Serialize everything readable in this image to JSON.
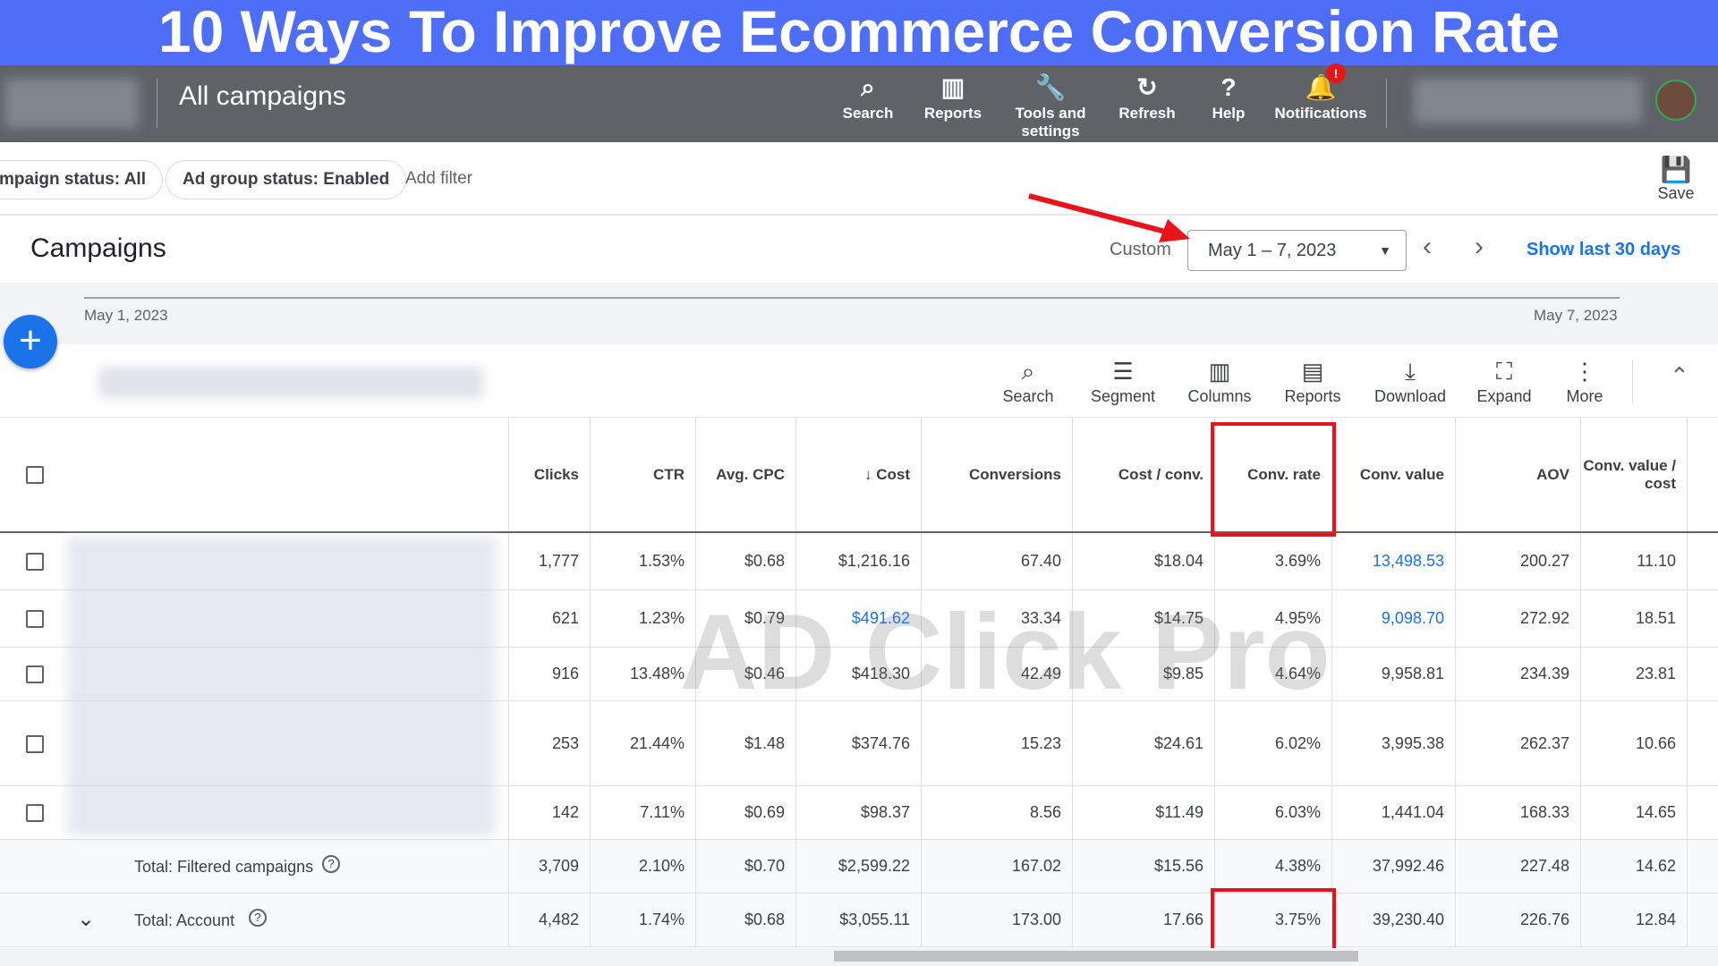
{
  "banner": {
    "title": "10 Ways To Improve Ecommerce Conversion Rate"
  },
  "header": {
    "title": "All campaigns",
    "icons": [
      {
        "label": "Search",
        "icon": "search-icon",
        "glyph": "⌕"
      },
      {
        "label": "Reports",
        "icon": "reports-icon",
        "glyph": "▥"
      },
      {
        "label": "Tools and settings",
        "icon": "wrench-icon",
        "glyph": "🔧"
      },
      {
        "label": "Refresh",
        "icon": "refresh-icon",
        "glyph": "↻"
      },
      {
        "label": "Help",
        "icon": "help-icon",
        "glyph": "?"
      },
      {
        "label": "Notifications",
        "icon": "bell-icon",
        "glyph": "🔔"
      }
    ],
    "notification_badge": "!"
  },
  "filters": {
    "chips": [
      "mpaign status: All",
      "Ad group status: Enabled"
    ],
    "add_filter": "Add filter",
    "save": "Save"
  },
  "campaigns": {
    "title": "Campaigns",
    "range_label": "Custom",
    "date_range": "May 1 – 7, 2023",
    "show_last": "Show last 30 days"
  },
  "timeline": {
    "start": "May 1, 2023",
    "end": "May 7, 2023"
  },
  "toolbar": [
    {
      "label": "Search",
      "icon": "search-icon",
      "glyph": "⌕"
    },
    {
      "label": "Segment",
      "icon": "segment-icon",
      "glyph": "☰"
    },
    {
      "label": "Columns",
      "icon": "columns-icon",
      "glyph": "▥"
    },
    {
      "label": "Reports",
      "icon": "reports-icon",
      "glyph": "▤"
    },
    {
      "label": "Download",
      "icon": "download-icon",
      "glyph": "⤓"
    },
    {
      "label": "Expand",
      "icon": "expand-icon",
      "glyph": "⛶"
    },
    {
      "label": "More",
      "icon": "more-vert-icon",
      "glyph": "⋮"
    }
  ],
  "table": {
    "columns": [
      "Clicks",
      "CTR",
      "Avg. CPC",
      "↓ Cost",
      "Conversions",
      "Cost / conv.",
      "Conv. rate",
      "Conv. value",
      "AOV",
      "Conv. value / cost"
    ],
    "rows": [
      [
        "1,777",
        "1.53%",
        "$0.68",
        "$1,216.16",
        "67.40",
        "$18.04",
        "3.69%",
        "13,498.53",
        "200.27",
        "11.10"
      ],
      [
        "621",
        "1.23%",
        "$0.79",
        "$491.62",
        "33.34",
        "$14.75",
        "4.95%",
        "9,098.70",
        "272.92",
        "18.51"
      ],
      [
        "916",
        "13.48%",
        "$0.46",
        "$418.30",
        "42.49",
        "$9.85",
        "4.64%",
        "9,958.81",
        "234.39",
        "23.81"
      ],
      [
        "253",
        "21.44%",
        "$1.48",
        "$374.76",
        "15.23",
        "$24.61",
        "6.02%",
        "3,995.38",
        "262.37",
        "10.66"
      ],
      [
        "142",
        "7.11%",
        "$0.69",
        "$98.37",
        "8.56",
        "$11.49",
        "6.03%",
        "1,441.04",
        "168.33",
        "14.65"
      ]
    ],
    "totals": [
      {
        "label": "Total: Filtered campaigns",
        "values": [
          "3,709",
          "2.10%",
          "$0.70",
          "$2,599.22",
          "167.02",
          "$15.56",
          "4.38%",
          "37,992.46",
          "227.48",
          "14.62"
        ]
      },
      {
        "label": "Total: Account",
        "values": [
          "4,482",
          "1.74%",
          "$0.68",
          "$3,055.11",
          "173.00",
          "17.66",
          "3.75%",
          "39,230.40",
          "226.76",
          "12.84"
        ]
      }
    ]
  },
  "watermark": "AD Click Pro",
  "colors": {
    "banner": "#4f6ef7",
    "topbar": "#5f6368",
    "link": "#1a73e8",
    "highlight": "#e8141a"
  }
}
